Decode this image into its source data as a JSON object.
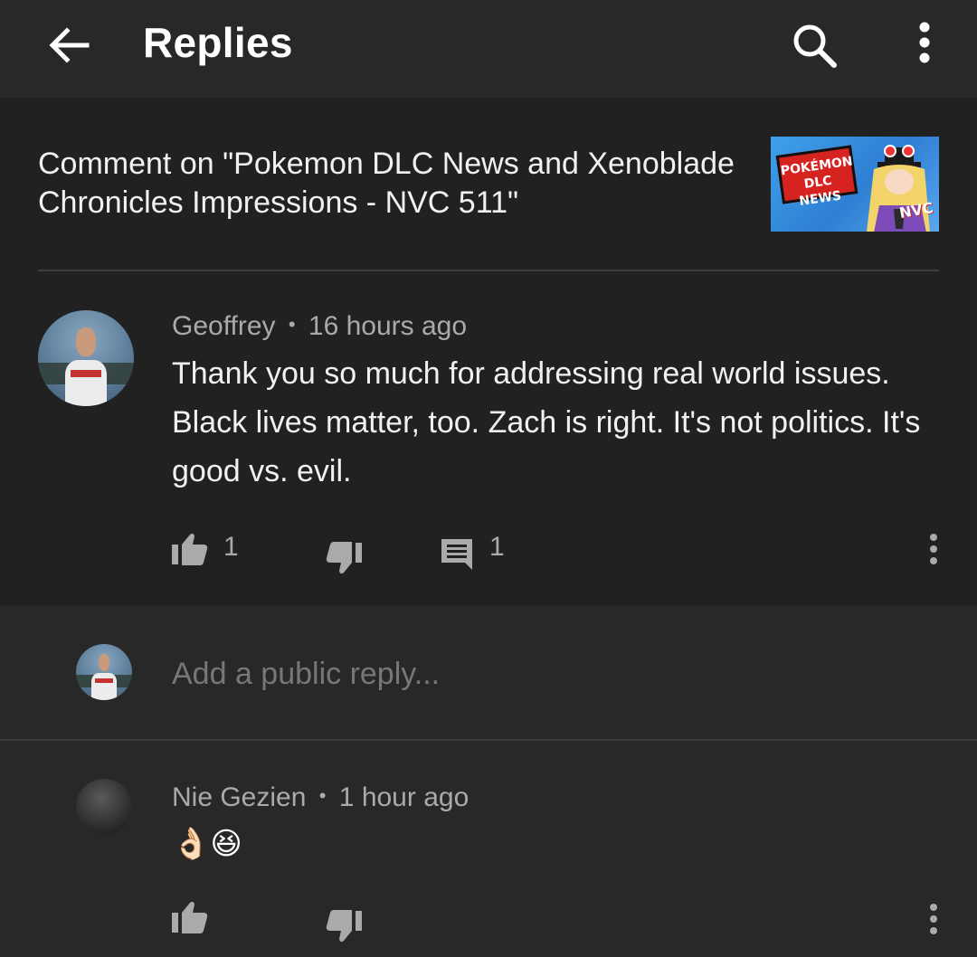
{
  "appbar": {
    "title": "Replies",
    "back_icon": "arrow-left-icon",
    "search_icon": "search-icon",
    "more_icon": "more-vert-icon"
  },
  "context": {
    "comment_on": "Comment on \"Pokemon DLC News and Xenoblade Chronicles Impressions - NVC 511\"",
    "thumbnail": {
      "badge_line1": "POKÉMON",
      "badge_line2": "DLC NEWS",
      "logo": "NVC"
    }
  },
  "comment": {
    "author": "Geoffrey",
    "separator": "•",
    "time": "16 hours ago",
    "text": "Thank you so much for addressing real world issues. Black lives matter, too. Zach is right.  It's not politics. It's good vs. evil.",
    "likes": "1",
    "replies": "1"
  },
  "reply_box": {
    "placeholder": "Add a public reply..."
  },
  "reply": {
    "author": "Nie Gezien",
    "separator": "•",
    "time": "1 hour ago",
    "emoji1": "👌🏻",
    "emoji2": "😆"
  },
  "colors": {
    "appbar_bg": "#282828",
    "content_bg": "#212121",
    "secondary_text": "#aaaaaa",
    "placeholder_text": "#777777"
  }
}
